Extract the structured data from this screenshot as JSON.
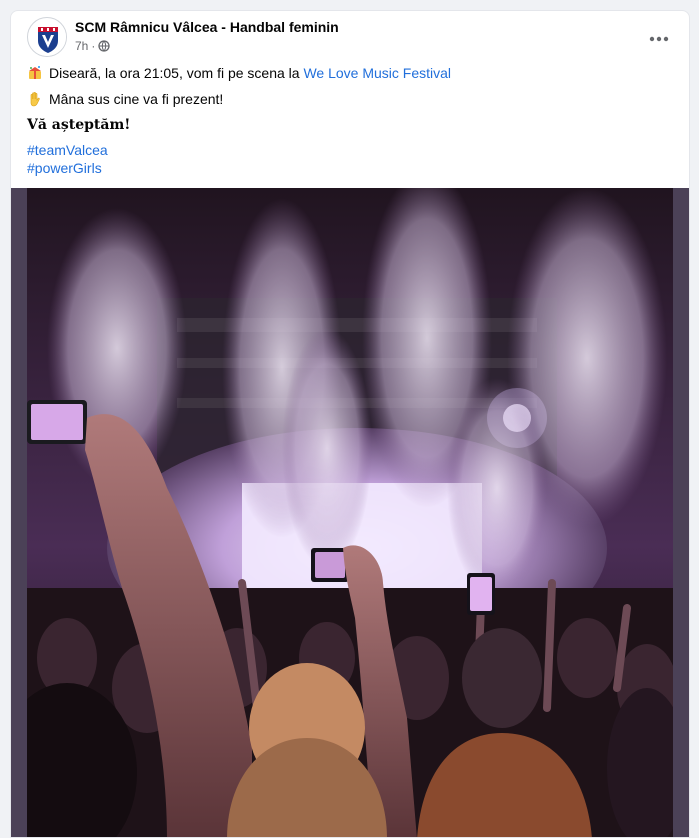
{
  "post": {
    "page_name": "SCM Râmnicu Vâlcea - Handbal feminin",
    "time": "7h",
    "privacy_icon": "globe-icon",
    "more_icon": "ellipsis-icon",
    "lines": {
      "line1_text": "Diseară, la ora 21:05, vom fi pe scena la ",
      "line1_link": "We Love Music Festival",
      "line1_icon": "confetti-emoji-icon",
      "line2_text": "Mâna sus cine va fi prezent!",
      "line2_icon": "raised-hand-emoji-icon",
      "line3_text": "Vă așteptăm!"
    },
    "hashtags": [
      "#teamValcea",
      "#powerGirls"
    ],
    "photo_icon": "concert-crowd-photo"
  },
  "colors": {
    "link": "#216fdb",
    "frame": "#4b4157",
    "stage_light": "#e9d9ff"
  }
}
